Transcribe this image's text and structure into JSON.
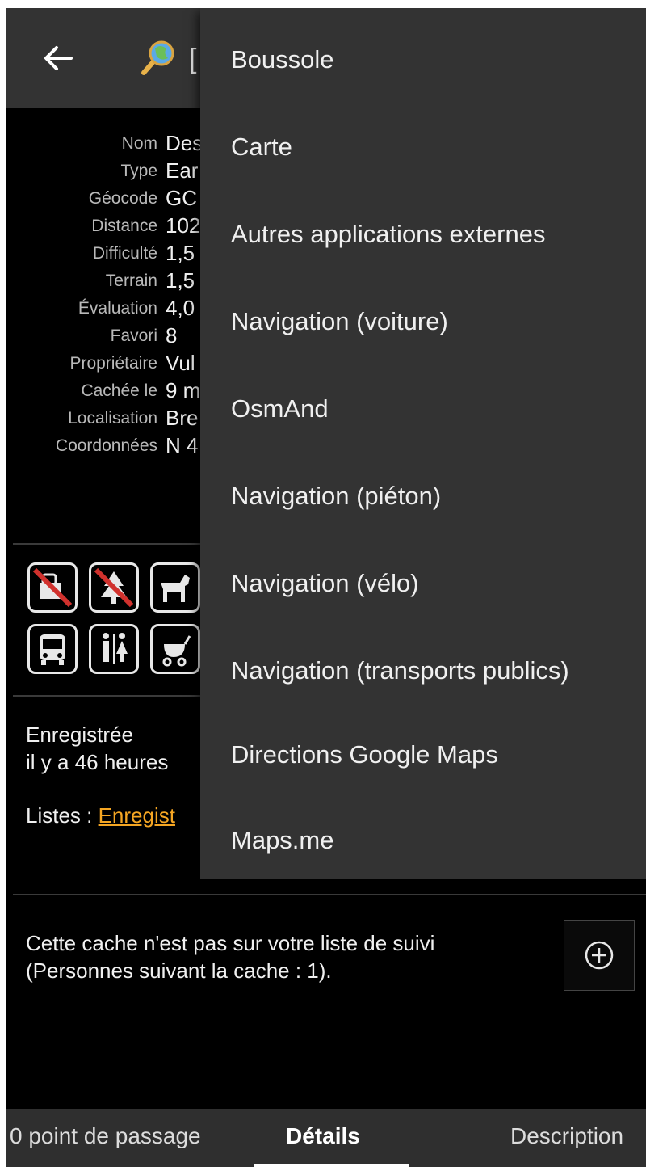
{
  "appbar": {
    "title_fragment": "["
  },
  "details": [
    {
      "label": "Nom",
      "value": "Des"
    },
    {
      "label": "Type",
      "value": "Ear"
    },
    {
      "label": "Géocode",
      "value": "GC"
    },
    {
      "label": "Distance",
      "value": "102"
    },
    {
      "label": "Difficulté",
      "value": "1,5"
    },
    {
      "label": "Terrain",
      "value": "1,5"
    },
    {
      "label": "Évaluation",
      "value": "4,0"
    },
    {
      "label": "Favori",
      "value": "8"
    },
    {
      "label": "Propriétaire",
      "value": "Vul"
    },
    {
      "label": "Cachée le",
      "value": "9 m"
    },
    {
      "label": "Localisation",
      "value": "Bre"
    },
    {
      "label": "Coordonnées",
      "value": "N 4"
    }
  ],
  "attributes": [
    "no-cache-box-icon",
    "no-tree-icon",
    "dog-icon",
    "bus-icon",
    "restroom-icon",
    "stroller-icon"
  ],
  "stored": {
    "line1": "Enregistrée",
    "line2": "il y a 46 heures"
  },
  "lists": {
    "label": "Listes : ",
    "link": "Enregist"
  },
  "watchlist": {
    "line1": "Cette cache n'est pas sur votre liste de suivi",
    "line2": "(Personnes suivant la cache : 1)."
  },
  "tabs": [
    "0 point de passage",
    "Détails",
    "Description"
  ],
  "menu": [
    "Boussole",
    "Carte",
    "Autres applications externes",
    "Navigation (voiture)",
    "OsmAnd",
    "Navigation (piéton)",
    "Navigation (vélo)",
    "Navigation (transports publics)",
    "Directions Google Maps",
    "Maps.me"
  ],
  "colors": {
    "appbar": "#333333",
    "background": "#000000",
    "link": "#f5a623",
    "menu": "#333333"
  }
}
